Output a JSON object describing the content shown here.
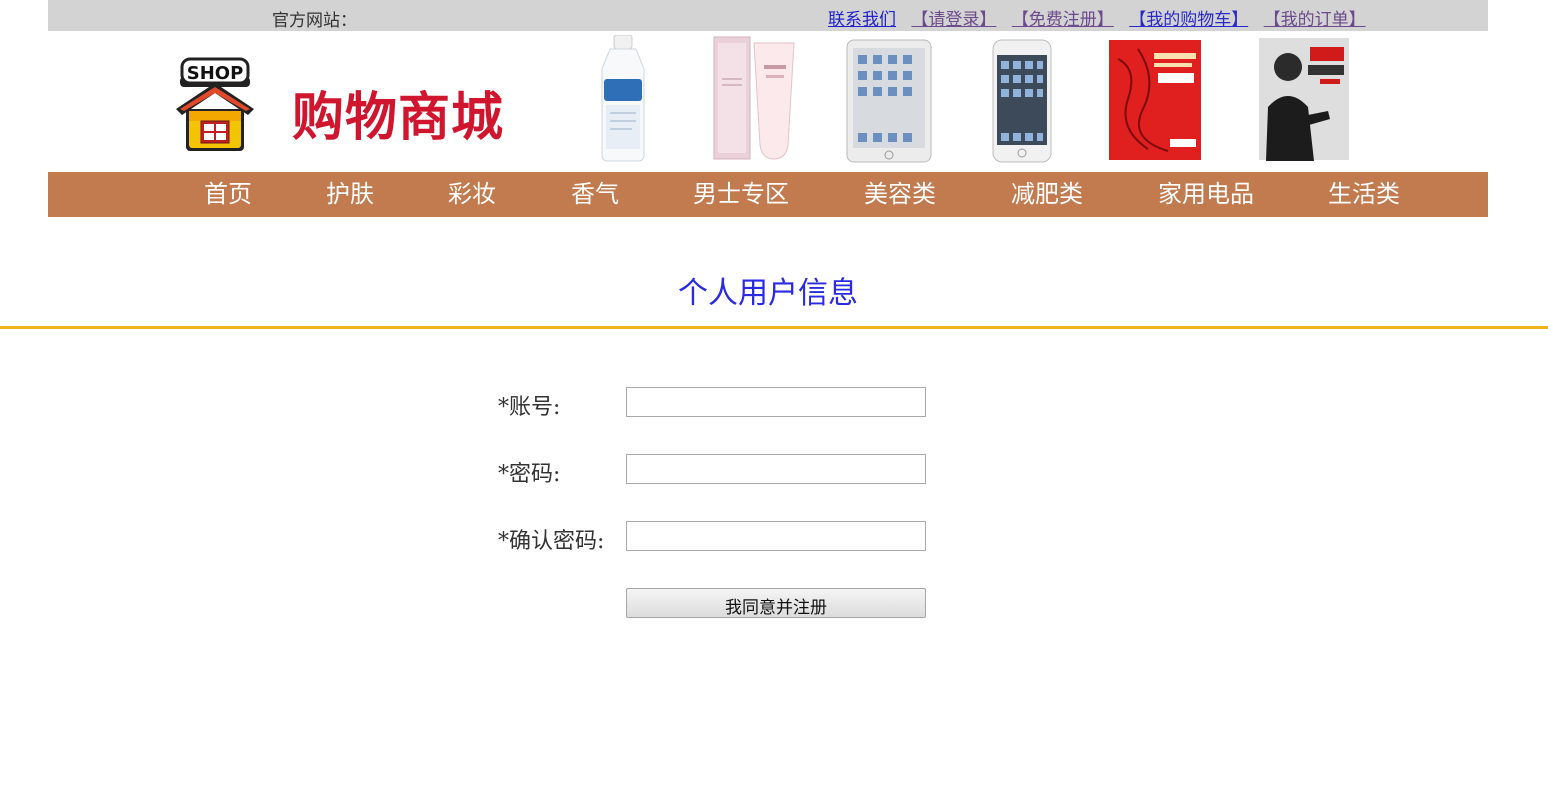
{
  "topbar": {
    "site_label": "官方网站：",
    "links": {
      "contact": "联系我们",
      "login": "【请登录】",
      "register": "【免费注册】",
      "cart": "【我的购物车】",
      "orders": "【我的订单】"
    }
  },
  "banner": {
    "logo_text": "SHOP",
    "brand_name": "购物商城",
    "products": [
      "cetaphil-lotion",
      "aupres-cleanser",
      "ipad-mini",
      "iphone",
      "java-book-red",
      "crazy-java-book"
    ]
  },
  "nav": {
    "items": [
      "首页",
      "护肤",
      "彩妆",
      "香气",
      "男士专区",
      "美容类",
      "减肥类",
      "家用电品",
      "生活类"
    ]
  },
  "main": {
    "title": "个人用户信息",
    "form": {
      "account_label": "*账号:",
      "account_value": "",
      "password_label": "*密码:",
      "password_value": "",
      "confirm_label": "*确认密码:",
      "confirm_value": "",
      "submit_label": "我同意并注册"
    }
  },
  "colors": {
    "topbar_bg": "#d3d3d3",
    "nav_bg": "#c27a4f",
    "brand_red": "#d0162e",
    "title_blue": "#2a2ae0",
    "divider_gold": "#f0b21a"
  }
}
